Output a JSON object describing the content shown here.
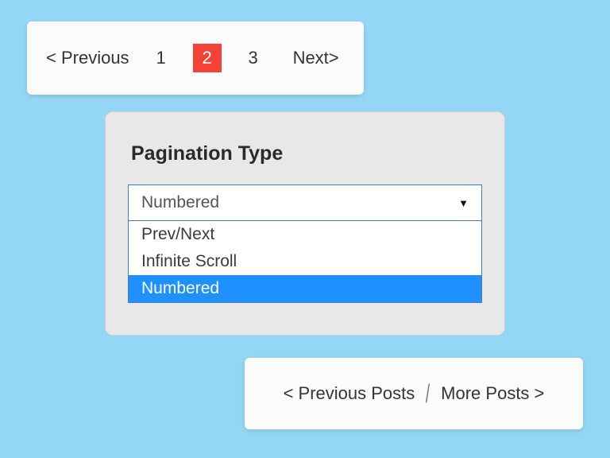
{
  "pagination": {
    "prev_label": "< Previous",
    "next_label": "Next>",
    "pages": [
      "1",
      "2",
      "3"
    ],
    "active_index": 1
  },
  "dropdown": {
    "title": "Pagination Type",
    "selected": "Numbered",
    "options": [
      "Prev/Next",
      "Infinite Scroll",
      "Numbered"
    ],
    "highlighted_index": 2
  },
  "prevnext": {
    "prev_label": "<  Previous Posts",
    "divider": "/",
    "next_label": "More Posts  >"
  },
  "colors": {
    "background": "#94d6f5",
    "active_page": "#f44336",
    "highlight": "#1e90ff",
    "border": "#3b7fbf"
  }
}
